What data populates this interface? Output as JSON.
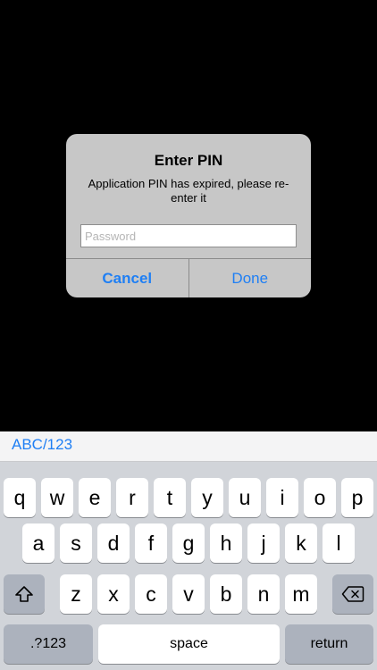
{
  "alert": {
    "title": "Enter PIN",
    "message": "Application PIN has expired, please re-enter it",
    "password_placeholder": "Password",
    "cancel_label": "Cancel",
    "done_label": "Done"
  },
  "keyboard": {
    "predict_label": "ABC/123",
    "row1": [
      "q",
      "w",
      "e",
      "r",
      "t",
      "y",
      "u",
      "i",
      "o",
      "p"
    ],
    "row2": [
      "a",
      "s",
      "d",
      "f",
      "g",
      "h",
      "j",
      "k",
      "l"
    ],
    "row3": [
      "z",
      "x",
      "c",
      "v",
      "b",
      "n",
      "m"
    ],
    "numbers_label": ".?123",
    "space_label": "space",
    "return_label": "return",
    "shift_icon": "shift-icon",
    "delete_icon": "delete-icon"
  },
  "colors": {
    "accent": "#1f7ff4",
    "alert_bg": "#c7c7c7",
    "keyboard_bg": "#d1d4d9"
  }
}
